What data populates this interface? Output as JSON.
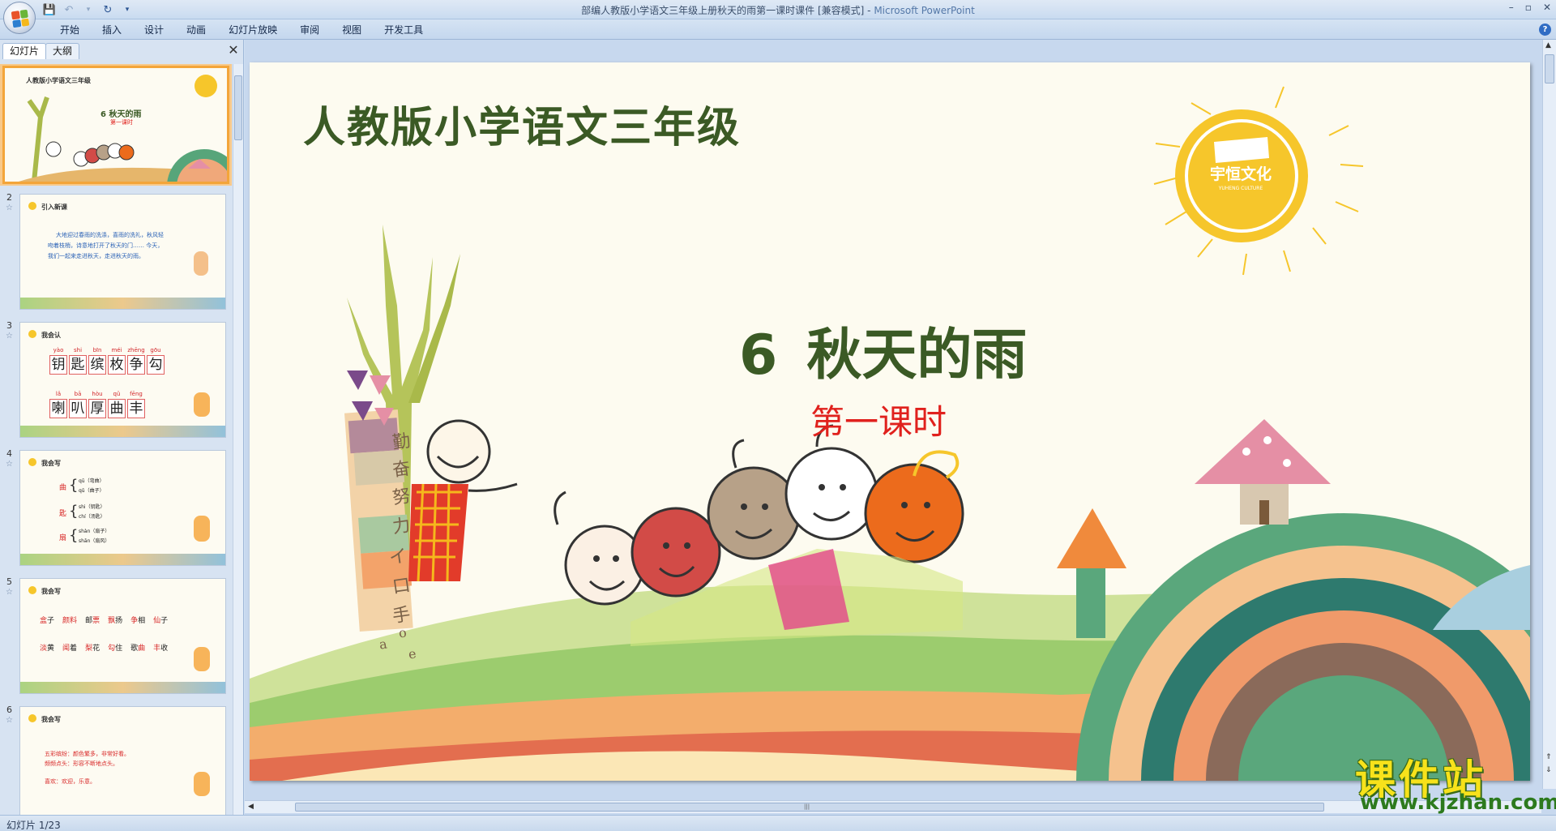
{
  "window": {
    "title": "部编人教版小学语文三年级上册秋天的雨第一课时课件 [兼容模式]",
    "app_name": "Microsoft PowerPoint",
    "controls": [
      "–",
      "▫",
      "✕"
    ]
  },
  "quick_access": [
    "save-icon",
    "undo-icon",
    "redo-icon",
    "customize-icon"
  ],
  "ribbon": {
    "tabs": [
      "开始",
      "插入",
      "设计",
      "动画",
      "幻灯片放映",
      "审阅",
      "视图",
      "开发工具"
    ],
    "help_label": "?"
  },
  "left_pane": {
    "tabs": [
      "幻灯片",
      "大纲"
    ],
    "close_label": "✕",
    "thumbnails": [
      {
        "num": "1",
        "header": "人教版小学语文三年级",
        "title": "6  秋天的雨",
        "sub": "第一课时"
      },
      {
        "num": "2",
        "header": "引入新课",
        "lines": [
          "大地迎过春雨的洗涤，喜雨的洗礼，秋风轻",
          "吻着枝梢，诗意地打开了秋天的门…… 今天，",
          "我们一起来走进秋天，走进秋天的雨。"
        ]
      },
      {
        "num": "3",
        "header": "我会认",
        "pinyin1": [
          "yào",
          "shi",
          "bīn",
          "méi",
          "zhēng",
          "gōu"
        ],
        "chars1": [
          "钥",
          "匙",
          "缤",
          "枚",
          "争",
          "勾"
        ],
        "pinyin2": [
          "lǎ",
          "bā",
          "hòu",
          "qǔ",
          "fēng"
        ],
        "chars2": [
          "喇",
          "叭",
          "厚",
          "曲",
          "丰"
        ]
      },
      {
        "num": "4",
        "header": "我会写",
        "groups": [
          {
            "char": "曲",
            "lines": [
              "qū（弯曲）",
              "qǔ（曲子）"
            ]
          },
          {
            "char": "匙",
            "lines": [
              "shi（钥匙）",
              "chí（汤匙）"
            ]
          },
          {
            "char": "扇",
            "lines": [
              "shàn（扇子）",
              "shān（扇风）"
            ]
          }
        ]
      },
      {
        "num": "5",
        "header": "我会写",
        "row1": [
          [
            "盒",
            "子"
          ],
          [
            "颜",
            "料"
          ],
          [
            "邮",
            "票"
          ],
          [
            "飘",
            "扬"
          ],
          [
            "争",
            "相"
          ],
          [
            "仙",
            "子"
          ]
        ],
        "row2": [
          [
            "淡",
            "黄"
          ],
          [
            "闻",
            "着"
          ],
          [
            "梨",
            "花"
          ],
          [
            "勾",
            "住"
          ],
          [
            "歌",
            "曲"
          ],
          [
            "丰",
            "收"
          ]
        ]
      },
      {
        "num": "6",
        "header": "我会写",
        "lines": [
          "五彩缤纷：颜色繁多，非常好看。",
          "频频点头：形容不断地点头。",
          "喜欢：欢迎，乐意。"
        ]
      }
    ]
  },
  "slide": {
    "header": "人教版小学语文三年级",
    "lesson_number": "6",
    "lesson_title": "秋天的雨",
    "subtitle": "第一课时",
    "logo_text": "宇恒文化",
    "logo_small": "YUHENG CULTURE",
    "trunk_words": [
      "勤",
      "奋",
      "努",
      "力",
      "イ",
      "口",
      "手",
      "o",
      "e",
      "a"
    ]
  },
  "colors": {
    "title_green": "#3b5a25",
    "subtitle_red": "#e0211d",
    "sun_yellow": "#f6c62b",
    "selection": "#f3a53a"
  },
  "status": {
    "slide_counter": "幻灯片 1/23"
  },
  "watermark": {
    "line1": "课件站",
    "line2": "www.kjzhan.com"
  }
}
